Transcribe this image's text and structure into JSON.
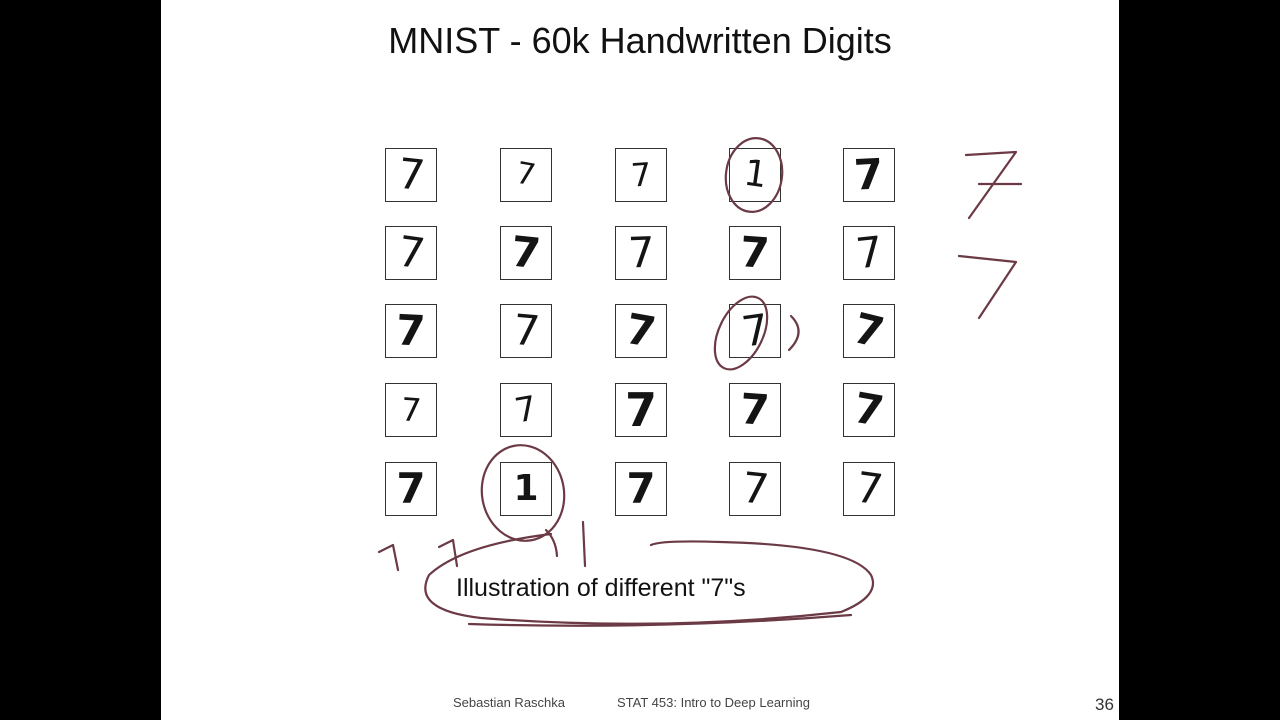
{
  "slide": {
    "title": "MNIST - 60k Handwritten Digits",
    "caption": "Illustration of different \"7\"s",
    "footer_author": "Sebastian Raschka",
    "footer_course": "STAT 453: Intro to Deep Learning",
    "page_number": "36"
  },
  "digit_grid": {
    "rows": [
      [
        "7",
        "7",
        "7",
        "1",
        "7"
      ],
      [
        "7",
        "7",
        "7",
        "7",
        "7"
      ],
      [
        "7",
        "7",
        "7",
        "7",
        "7"
      ],
      [
        "7",
        "7",
        "7",
        "7",
        "7"
      ],
      [
        "7",
        "1",
        "7",
        "7",
        "7"
      ]
    ]
  },
  "annotations": {
    "ink_color": "#6b3a45",
    "margin_sevens": [
      "7",
      "7"
    ]
  }
}
